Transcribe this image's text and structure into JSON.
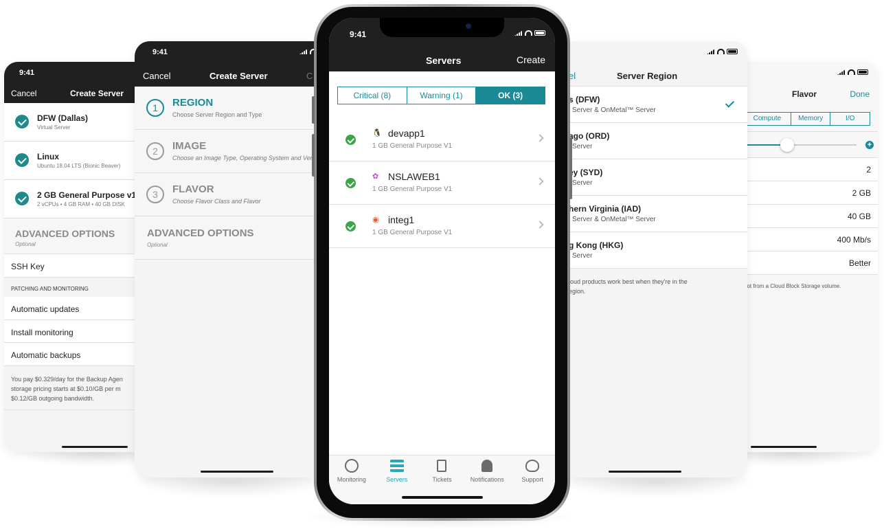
{
  "colors": {
    "accent": "#1f8a8c",
    "header_bg": "#202020",
    "ok_tab": "#1a8a97"
  },
  "phone1": {
    "time": "9:41",
    "cancel": "Cancel",
    "title": "Create Server",
    "rows": [
      {
        "title": "DFW (Dallas)",
        "sub": "Virtual Server"
      },
      {
        "title": "Linux",
        "sub": "Ubuntu 18.04 LTS (Bionic Beaver)"
      },
      {
        "title": "2 GB General Purpose v1",
        "sub": "2 vCPUs • 4 GB RAM • 40 GB DISK"
      }
    ],
    "advanced": "ADVANCED OPTIONS",
    "advanced_sub": "Optional",
    "ssh_key": "SSH Key",
    "patching_header": "PATCHING AND MONITORING",
    "auto_updates": "Automatic updates",
    "install_monitoring": "Install monitoring",
    "auto_backups": "Automatic backups",
    "note_line1": "You pay $0.329/day for the Backup Agen",
    "note_line2": "storage pricing starts at $0.10/GB per m",
    "note_line3": "$0.12/GB outgoing bandwidth."
  },
  "phone2": {
    "time": "9:41",
    "cancel": "Cancel",
    "title": "Create Server",
    "right_partial": "C",
    "steps": [
      {
        "num": "1",
        "title": "REGION",
        "sub": "Choose Server Region and Type"
      },
      {
        "num": "2",
        "title": "IMAGE",
        "sub": "Choose an Image Type, Operating System and Vers"
      },
      {
        "num": "3",
        "title": "FLAVOR",
        "sub": "Choose Flavor Class and Flavor"
      }
    ],
    "advanced": "ADVANCED OPTIONS",
    "advanced_sub": "Optional"
  },
  "phone3": {
    "time": "9:41",
    "title": "Servers",
    "create": "Create",
    "tabs": [
      {
        "label": "Critical (8)",
        "active": false
      },
      {
        "label": "Warning (1)",
        "active": false
      },
      {
        "label": "OK (3)",
        "active": true
      }
    ],
    "servers": [
      {
        "name": "devapp1",
        "sub": "1 GB General Purpose V1",
        "os_icon": "linux-penguin-icon"
      },
      {
        "name": "NSLAWEB1",
        "sub": "1 GB General Purpose V1",
        "os_icon": "cluster-icon"
      },
      {
        "name": "integ1",
        "sub": "1 GB General Purpose V1",
        "os_icon": "ubuntu-icon"
      }
    ],
    "tabbar": [
      {
        "label": "Monitoring",
        "icon": "monitoring-icon",
        "active": false
      },
      {
        "label": "Servers",
        "icon": "servers-icon",
        "active": true
      },
      {
        "label": "Tickets",
        "icon": "tickets-icon",
        "active": false
      },
      {
        "label": "Notifications",
        "icon": "bell-icon",
        "active": false
      },
      {
        "label": "Support",
        "icon": "headset-icon",
        "active": false
      }
    ]
  },
  "phone4": {
    "cancel_partial": "el",
    "title": "Server Region",
    "regions": [
      {
        "title": "s (DFW)",
        "sub": "l Server & OnMetal™ Server",
        "selected": true
      },
      {
        "title": "ago (ORD)",
        "sub": "l Server",
        "selected": false
      },
      {
        "title": "ey (SYD)",
        "sub": "l Server",
        "selected": false
      },
      {
        "title": "hern Virginia (IAD)",
        "sub": "l Server & OnMetal™ Server",
        "selected": false
      },
      {
        "title": "g Kong (HKG)",
        "sub": "l Server",
        "selected": false
      }
    ],
    "note_line1": "loud products work best when they're in the",
    "note_line2": "egion."
  },
  "phone5": {
    "title": "Flavor",
    "done": "Done",
    "segments": [
      "Compute",
      "Memory",
      "I/O"
    ],
    "slider_value": 0.2,
    "rows": [
      "2",
      "2 GB",
      "40 GB",
      "400 Mb/s",
      "Better"
    ],
    "note": "oot from a Cloud Block Storage volume."
  }
}
